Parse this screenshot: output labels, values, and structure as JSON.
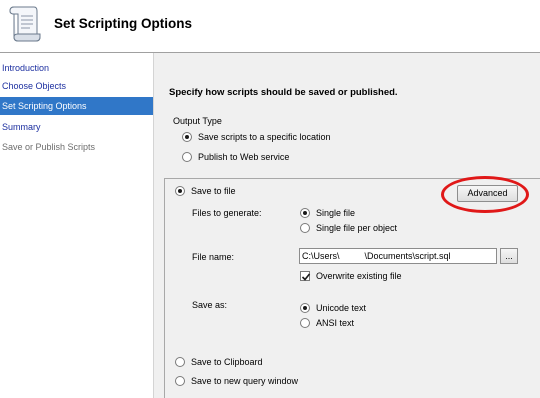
{
  "header": {
    "title": "Set Scripting Options",
    "icon": "scroll-icon"
  },
  "sidebar": {
    "items": [
      {
        "label": "Introduction",
        "state": "link"
      },
      {
        "label": "Choose Objects",
        "state": "link"
      },
      {
        "label": "Set Scripting Options",
        "state": "active"
      },
      {
        "label": "Summary",
        "state": "link"
      },
      {
        "label": "Save or Publish Scripts",
        "state": "disabled"
      }
    ]
  },
  "main": {
    "heading": "Specify how scripts should be saved or published.",
    "output_type": {
      "label": "Output Type",
      "options": [
        {
          "label": "Save scripts to a specific location",
          "checked": true
        },
        {
          "label": "Publish to Web service",
          "checked": false
        }
      ]
    },
    "save_options": {
      "save_to_file": {
        "label": "Save to file",
        "checked": true
      },
      "advanced_label": "Advanced",
      "files_to_generate": {
        "label": "Files to generate:",
        "options": [
          {
            "label": "Single file",
            "checked": true
          },
          {
            "label": "Single file per object",
            "checked": false
          }
        ]
      },
      "file_name": {
        "label": "File name:",
        "value": "C:\\Users\\          \\Documents\\script.sql",
        "browse_label": "..."
      },
      "overwrite": {
        "label": "Overwrite existing file",
        "checked": true
      },
      "save_as": {
        "label": "Save as:",
        "options": [
          {
            "label": "Unicode text",
            "checked": true
          },
          {
            "label": "ANSI text",
            "checked": false
          }
        ]
      },
      "save_to_clipboard": {
        "label": "Save to Clipboard",
        "checked": false
      },
      "save_to_query_window": {
        "label": "Save to new query window",
        "checked": false
      }
    }
  },
  "colors": {
    "active_nav": "#3077c8",
    "link": "#1c2fa0",
    "highlight": "#e01818",
    "panel_bg": "#f0f0f0"
  }
}
